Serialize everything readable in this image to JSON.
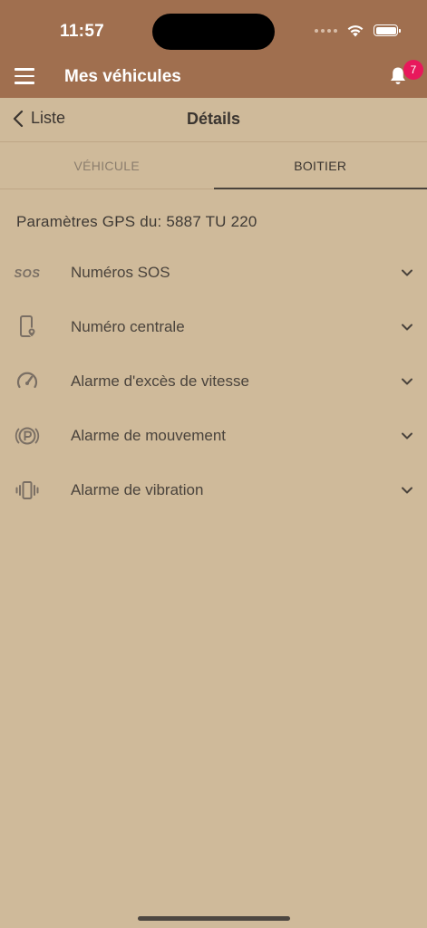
{
  "status_bar": {
    "time": "11:57"
  },
  "header": {
    "title": "Mes véhicules",
    "notification_count": "7"
  },
  "subnav": {
    "back_label": "Liste",
    "title": "Détails"
  },
  "tabs": [
    {
      "label": "VÉHICULE",
      "active": false
    },
    {
      "label": "BOITIER",
      "active": true
    }
  ],
  "section": {
    "title": "Paramètres GPS du: 5887 TU 220"
  },
  "items": [
    {
      "label": "Numéros SOS",
      "icon": "sos-icon"
    },
    {
      "label": "Numéro centrale",
      "icon": "phone-location-icon"
    },
    {
      "label": "Alarme d'excès de vitesse",
      "icon": "speedometer-icon"
    },
    {
      "label": "Alarme de mouvement",
      "icon": "parking-icon"
    },
    {
      "label": "Alarme de vibration",
      "icon": "vibration-icon"
    }
  ],
  "icon_texts": {
    "sos": "SOS"
  },
  "colors": {
    "header_bg": "#a06f4f",
    "page_bg": "#cfba9a",
    "badge": "#e8185c"
  }
}
